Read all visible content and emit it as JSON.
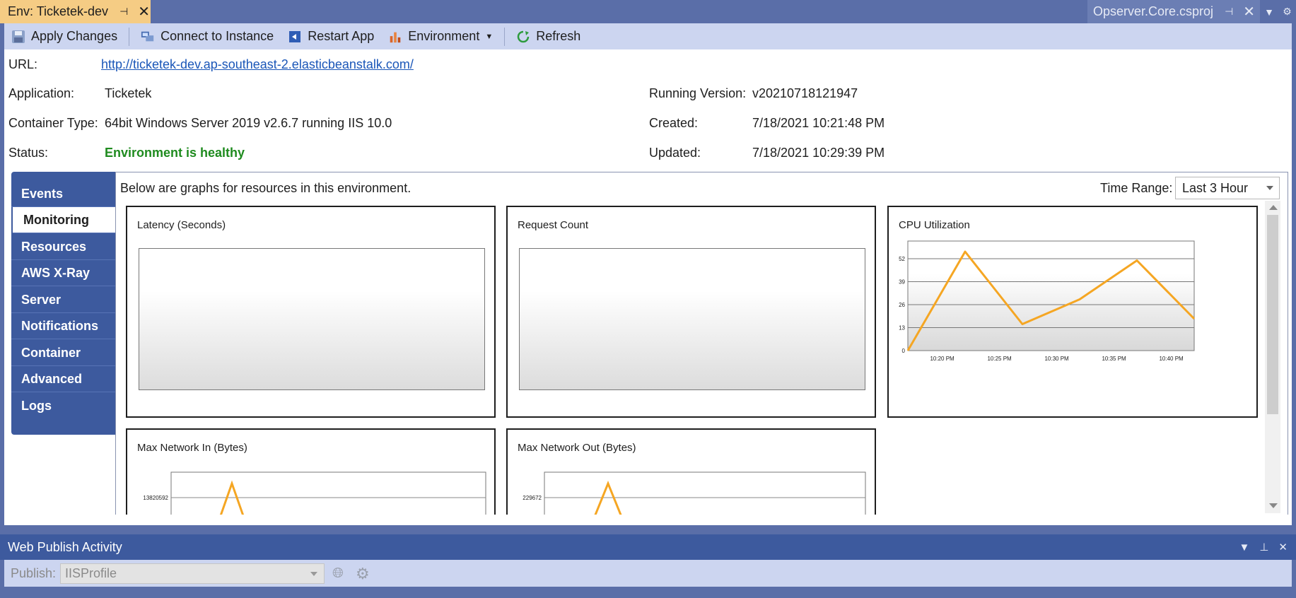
{
  "tabs": {
    "doc_title": "Env: Ticketek-dev",
    "right_title": "Opserver.Core.csproj"
  },
  "toolbar": {
    "apply": "Apply Changes",
    "connect": "Connect to Instance",
    "restart": "Restart App",
    "environment": "Environment",
    "refresh": "Refresh"
  },
  "info": {
    "url_label": "URL:",
    "url_value": "http://ticketek-dev.ap-southeast-2.elasticbeanstalk.com/",
    "app_label": "Application:",
    "app_value": "Ticketek",
    "container_label": "Container Type:",
    "container_value": "64bit Windows Server 2019 v2.6.7 running IIS 10.0",
    "status_label": "Status:",
    "status_value": "Environment is healthy",
    "version_label": "Running Version:",
    "version_value": "v20210718121947",
    "created_label": "Created:",
    "created_value": "7/18/2021 10:21:48 PM",
    "updated_label": "Updated:",
    "updated_value": "7/18/2021 10:29:39 PM"
  },
  "nav": [
    "Events",
    "Monitoring",
    "Resources",
    "AWS X-Ray",
    "Server",
    "Notifications",
    "Container",
    "Advanced",
    "Logs"
  ],
  "monitor": {
    "intro": "Below are graphs for resources in this environment.",
    "time_range_label": "Time Range:",
    "time_range_value": "Last 3 Hour"
  },
  "charts": {
    "latency": "Latency (Seconds)",
    "request": "Request Count",
    "cpu": "CPU Utilization",
    "net_in": "Max Network In (Bytes)",
    "net_out": "Max Network Out (Bytes)"
  },
  "chart_data": [
    {
      "type": "line",
      "title": "Latency (Seconds)",
      "series": []
    },
    {
      "type": "line",
      "title": "Request Count",
      "series": []
    },
    {
      "type": "line",
      "title": "CPU Utilization",
      "color": "#f5a623",
      "x": [
        "10:17 PM",
        "10:22 PM",
        "10:27 PM",
        "10:32 PM",
        "10:37 PM",
        "10:42 PM"
      ],
      "values": [
        0,
        56,
        15,
        29,
        51,
        18
      ],
      "xticks": [
        "10:20 PM",
        "10:25 PM",
        "10:30 PM",
        "10:35 PM",
        "10:40 PM"
      ],
      "yticks": [
        0,
        13,
        26,
        39,
        52
      ],
      "ylim": [
        0,
        62
      ],
      "grid": true
    },
    {
      "type": "line",
      "title": "Max Network In (Bytes)",
      "yticks": [
        13820592
      ],
      "color": "#f5a623"
    },
    {
      "type": "line",
      "title": "Max Network Out (Bytes)",
      "yticks": [
        229672
      ],
      "color": "#f5a623"
    }
  ],
  "publish": {
    "title": "Web Publish Activity",
    "label": "Publish:",
    "profile": "IISProfile"
  }
}
